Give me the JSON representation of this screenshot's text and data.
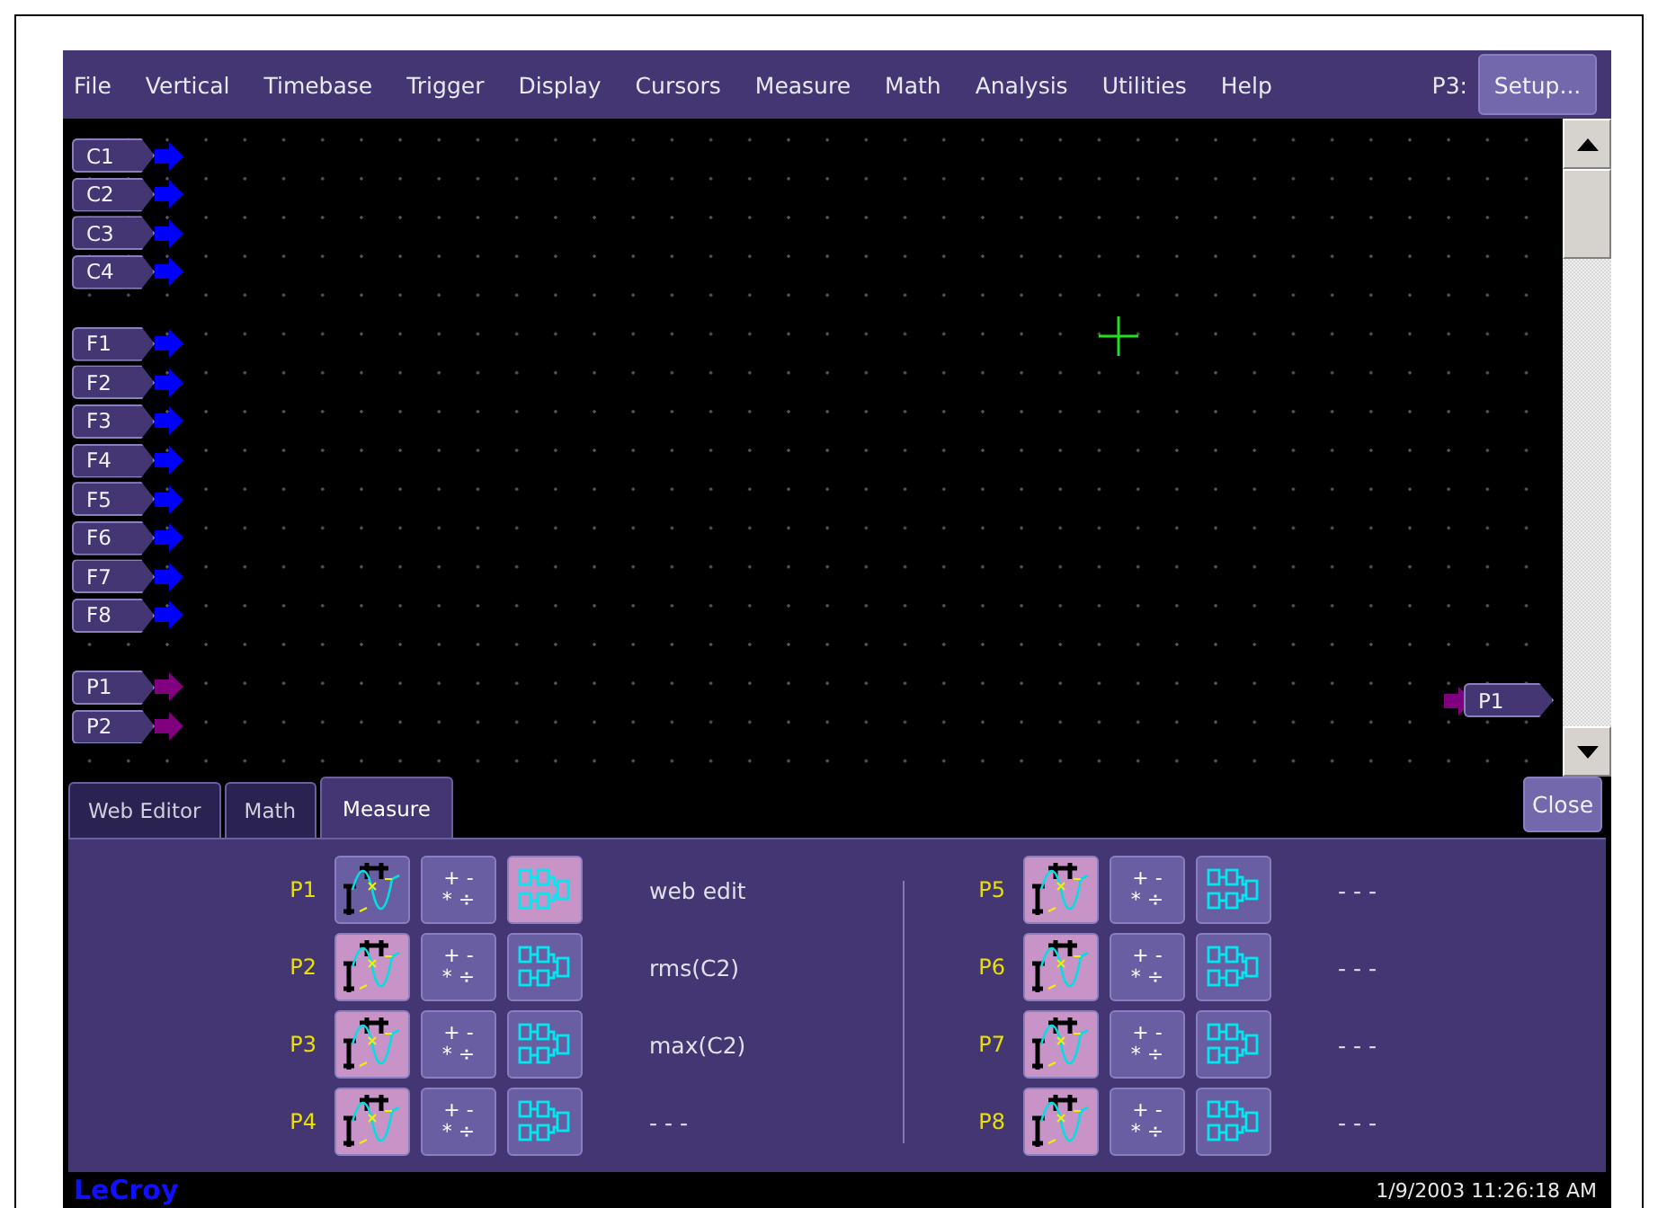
{
  "menu": {
    "items": [
      "File",
      "Vertical",
      "Timebase",
      "Trigger",
      "Display",
      "Cursors",
      "Measure",
      "Math",
      "Analysis",
      "Utilities",
      "Help"
    ],
    "context_label": "P3:",
    "setup_button": "Setup..."
  },
  "trace_groups": [
    [
      {
        "label": "C1",
        "color": "#0000ff"
      },
      {
        "label": "C2",
        "color": "#0000ff"
      },
      {
        "label": "C3",
        "color": "#0000ff"
      },
      {
        "label": "C4",
        "color": "#0000ff"
      }
    ],
    [
      {
        "label": "F1",
        "color": "#0000ff"
      },
      {
        "label": "F2",
        "color": "#0000ff"
      },
      {
        "label": "F3",
        "color": "#0000ff"
      },
      {
        "label": "F4",
        "color": "#0000ff"
      },
      {
        "label": "F5",
        "color": "#0000ff"
      },
      {
        "label": "F6",
        "color": "#0000ff"
      },
      {
        "label": "F7",
        "color": "#0000ff"
      },
      {
        "label": "F8",
        "color": "#0000ff"
      }
    ],
    [
      {
        "label": "P1",
        "color": "#800080"
      },
      {
        "label": "P2",
        "color": "#800080"
      }
    ]
  ],
  "right_marker": {
    "label": "P1",
    "color": "#800080"
  },
  "tabs": [
    {
      "label": "Web Editor",
      "selected": false
    },
    {
      "label": "Math",
      "selected": false
    },
    {
      "label": "Measure",
      "selected": true
    }
  ],
  "close_button": "Close",
  "params": [
    {
      "label": "P1",
      "value": "web edit",
      "buttons": [
        {
          "kind": "wave",
          "selected": false
        },
        {
          "kind": "arith",
          "selected": false,
          "symbols": [
            "+ -",
            "* ÷"
          ]
        },
        {
          "kind": "block",
          "selected": true
        }
      ]
    },
    {
      "label": "P2",
      "value": "rms(C2)",
      "buttons": [
        {
          "kind": "wave",
          "selected": true
        },
        {
          "kind": "arith",
          "selected": false,
          "symbols": [
            "+ -",
            "* ÷"
          ]
        },
        {
          "kind": "block",
          "selected": false
        }
      ]
    },
    {
      "label": "P3",
      "value": "max(C2)",
      "buttons": [
        {
          "kind": "wave",
          "selected": true
        },
        {
          "kind": "arith",
          "selected": false,
          "symbols": [
            "+ -",
            "* ÷"
          ]
        },
        {
          "kind": "block",
          "selected": false
        }
      ]
    },
    {
      "label": "P4",
      "value": "- - -",
      "buttons": [
        {
          "kind": "wave",
          "selected": true
        },
        {
          "kind": "arith",
          "selected": false,
          "symbols": [
            "+ -",
            "* ÷"
          ]
        },
        {
          "kind": "block",
          "selected": false
        }
      ]
    },
    {
      "label": "P5",
      "value": "- - -",
      "buttons": [
        {
          "kind": "wave",
          "selected": true
        },
        {
          "kind": "arith",
          "selected": false,
          "symbols": [
            "+ -",
            "* ÷"
          ]
        },
        {
          "kind": "block",
          "selected": false
        }
      ]
    },
    {
      "label": "P6",
      "value": "- - -",
      "buttons": [
        {
          "kind": "wave",
          "selected": true
        },
        {
          "kind": "arith",
          "selected": false,
          "symbols": [
            "+ -",
            "* ÷"
          ]
        },
        {
          "kind": "block",
          "selected": false
        }
      ]
    },
    {
      "label": "P7",
      "value": "- - -",
      "buttons": [
        {
          "kind": "wave",
          "selected": true
        },
        {
          "kind": "arith",
          "selected": false,
          "symbols": [
            "+ -",
            "* ÷"
          ]
        },
        {
          "kind": "block",
          "selected": false
        }
      ]
    },
    {
      "label": "P8",
      "value": "- - -",
      "buttons": [
        {
          "kind": "wave",
          "selected": true
        },
        {
          "kind": "arith",
          "selected": false,
          "symbols": [
            "+ -",
            "* ÷"
          ]
        },
        {
          "kind": "block",
          "selected": false
        }
      ]
    }
  ],
  "footer": {
    "logo": "LeCroy",
    "timestamp": "1/9/2003 11:26:18 AM"
  }
}
